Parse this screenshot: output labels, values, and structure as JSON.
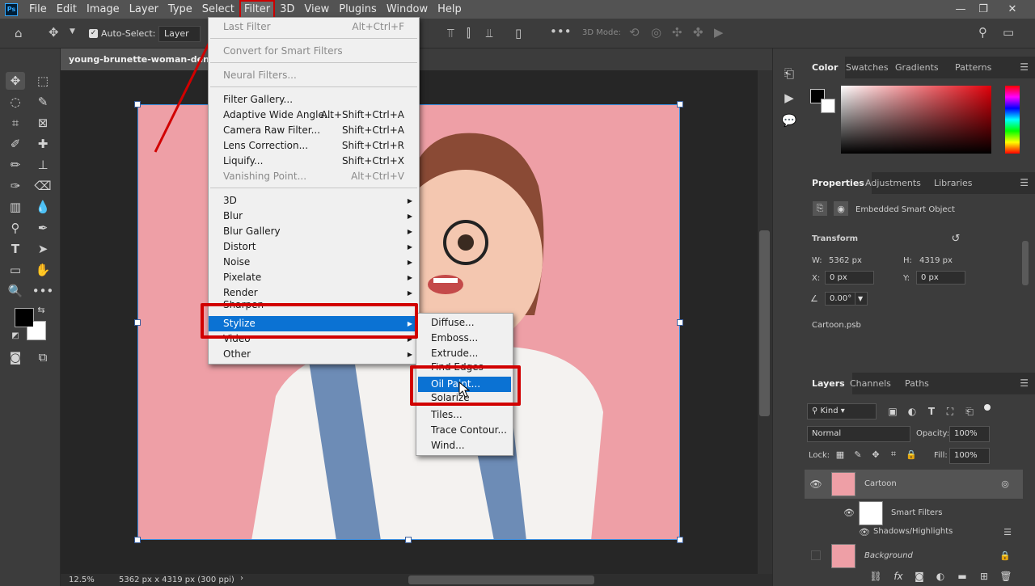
{
  "menubar": {
    "logo": "Ps",
    "items": [
      "File",
      "Edit",
      "Image",
      "Layer",
      "Type",
      "Select",
      "Filter",
      "3D",
      "View",
      "Plugins",
      "Window",
      "Help"
    ]
  },
  "options": {
    "auto_select_label": "Auto-Select:",
    "auto_select_value": "Layer",
    "mode_3d": "3D Mode:"
  },
  "document": {
    "tab_title": "young-brunette-woman-denim-c",
    "zoom": "12.5%",
    "dimensions": "5362 px x 4319 px (300 ppi)"
  },
  "filter_menu": {
    "items": [
      {
        "label": "Last Filter",
        "shortcut": "Alt+Ctrl+F",
        "disabled": true
      },
      {
        "label": "Convert for Smart Filters",
        "disabled": true
      },
      {
        "label": "Neural Filters...",
        "disabled": true
      },
      {
        "label": "Filter Gallery..."
      },
      {
        "label": "Adaptive Wide Angle...",
        "shortcut": "Alt+Shift+Ctrl+A"
      },
      {
        "label": "Camera Raw Filter...",
        "shortcut": "Shift+Ctrl+A"
      },
      {
        "label": "Lens Correction...",
        "shortcut": "Shift+Ctrl+R"
      },
      {
        "label": "Liquify...",
        "shortcut": "Shift+Ctrl+X"
      },
      {
        "label": "Vanishing Point...",
        "shortcut": "Alt+Ctrl+V",
        "disabled": true
      },
      {
        "label": "3D"
      },
      {
        "label": "Blur"
      },
      {
        "label": "Blur Gallery"
      },
      {
        "label": "Distort"
      },
      {
        "label": "Noise"
      },
      {
        "label": "Pixelate"
      },
      {
        "label": "Render"
      },
      {
        "label": "Sharpen"
      },
      {
        "label": "Stylize",
        "highlighted": true
      },
      {
        "label": "Video"
      },
      {
        "label": "Other"
      }
    ]
  },
  "stylize_menu": {
    "items": [
      "Diffuse...",
      "Emboss...",
      "Extrude...",
      "Find Edges",
      "Oil Paint...",
      "Solarize",
      "Tiles...",
      "Trace Contour...",
      "Wind..."
    ],
    "highlighted": "Oil Paint..."
  },
  "color_panel": {
    "tabs": [
      "Color",
      "Swatches",
      "Gradients",
      "Patterns"
    ],
    "active": "Color"
  },
  "properties_panel": {
    "tabs": [
      "Properties",
      "Adjustments",
      "Libraries"
    ],
    "type": "Embedded Smart Object",
    "transform_label": "Transform",
    "w_label": "W:",
    "w_value": "5362 px",
    "h_label": "H:",
    "h_value": "4319 px",
    "x_label": "X:",
    "x_value": "0 px",
    "y_label": "Y:",
    "y_value": "0 px",
    "angle_value": "0.00°",
    "filename": "Cartoon.psb"
  },
  "layers_panel": {
    "tabs": [
      "Layers",
      "Channels",
      "Paths"
    ],
    "filter_kind": "Kind",
    "blend_mode": "Normal",
    "opacity_label": "Opacity:",
    "opacity_value": "100%",
    "lock_label": "Lock:",
    "fill_label": "Fill:",
    "fill_value": "100%",
    "layers": [
      {
        "name": "Cartoon"
      },
      {
        "name": "Smart Filters"
      },
      {
        "name": "Shadows/Highlights"
      },
      {
        "name": "Background"
      }
    ]
  },
  "colors": {
    "foreground": "#000000",
    "background": "#ffffff",
    "canvas_bg": "#ee9fa6",
    "highlight": "#0b72d3",
    "annotation_red": "#d10000"
  }
}
